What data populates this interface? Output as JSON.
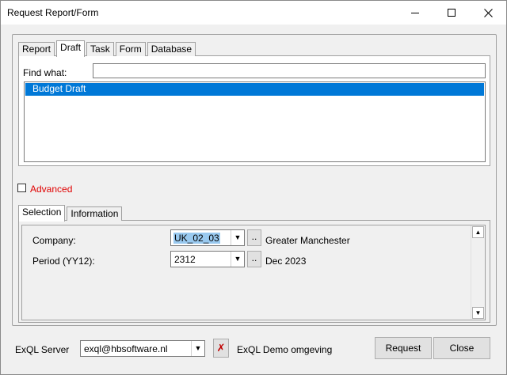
{
  "window": {
    "title": "Request Report/Form"
  },
  "top_tabs": [
    "Report",
    "Draft",
    "Task",
    "Form",
    "Database"
  ],
  "top_active_tab": "Draft",
  "find": {
    "label": "Find what:",
    "value": ""
  },
  "list": {
    "items": [
      "Budget Draft"
    ],
    "selected": "Budget Draft"
  },
  "advanced": {
    "label": "Advanced",
    "checked": false
  },
  "bottom_tabs": [
    "Selection",
    "Information"
  ],
  "bottom_active_tab": "Selection",
  "fields": {
    "company": {
      "label": "Company:",
      "value": "UK_02_03",
      "button": "..",
      "desc": "Greater Manchester"
    },
    "period": {
      "label": "Period (YY12):",
      "value": "2312",
      "button": "..",
      "desc": "Dec 2023"
    }
  },
  "server": {
    "label": "ExQL Server",
    "value": "exql@hbsoftware.nl",
    "desc": "ExQL Demo omgeving"
  },
  "buttons": {
    "request": "Request",
    "close": "Close"
  },
  "icons": {
    "minimize": "minimize-icon",
    "maximize": "maximize-icon",
    "close": "close-icon",
    "dropdown": "chevron-down-icon",
    "clear": "red-x-icon"
  },
  "colors": {
    "selection": "#0078d7",
    "advanced_text": "#e00000",
    "clear_icon": "#c00000"
  }
}
